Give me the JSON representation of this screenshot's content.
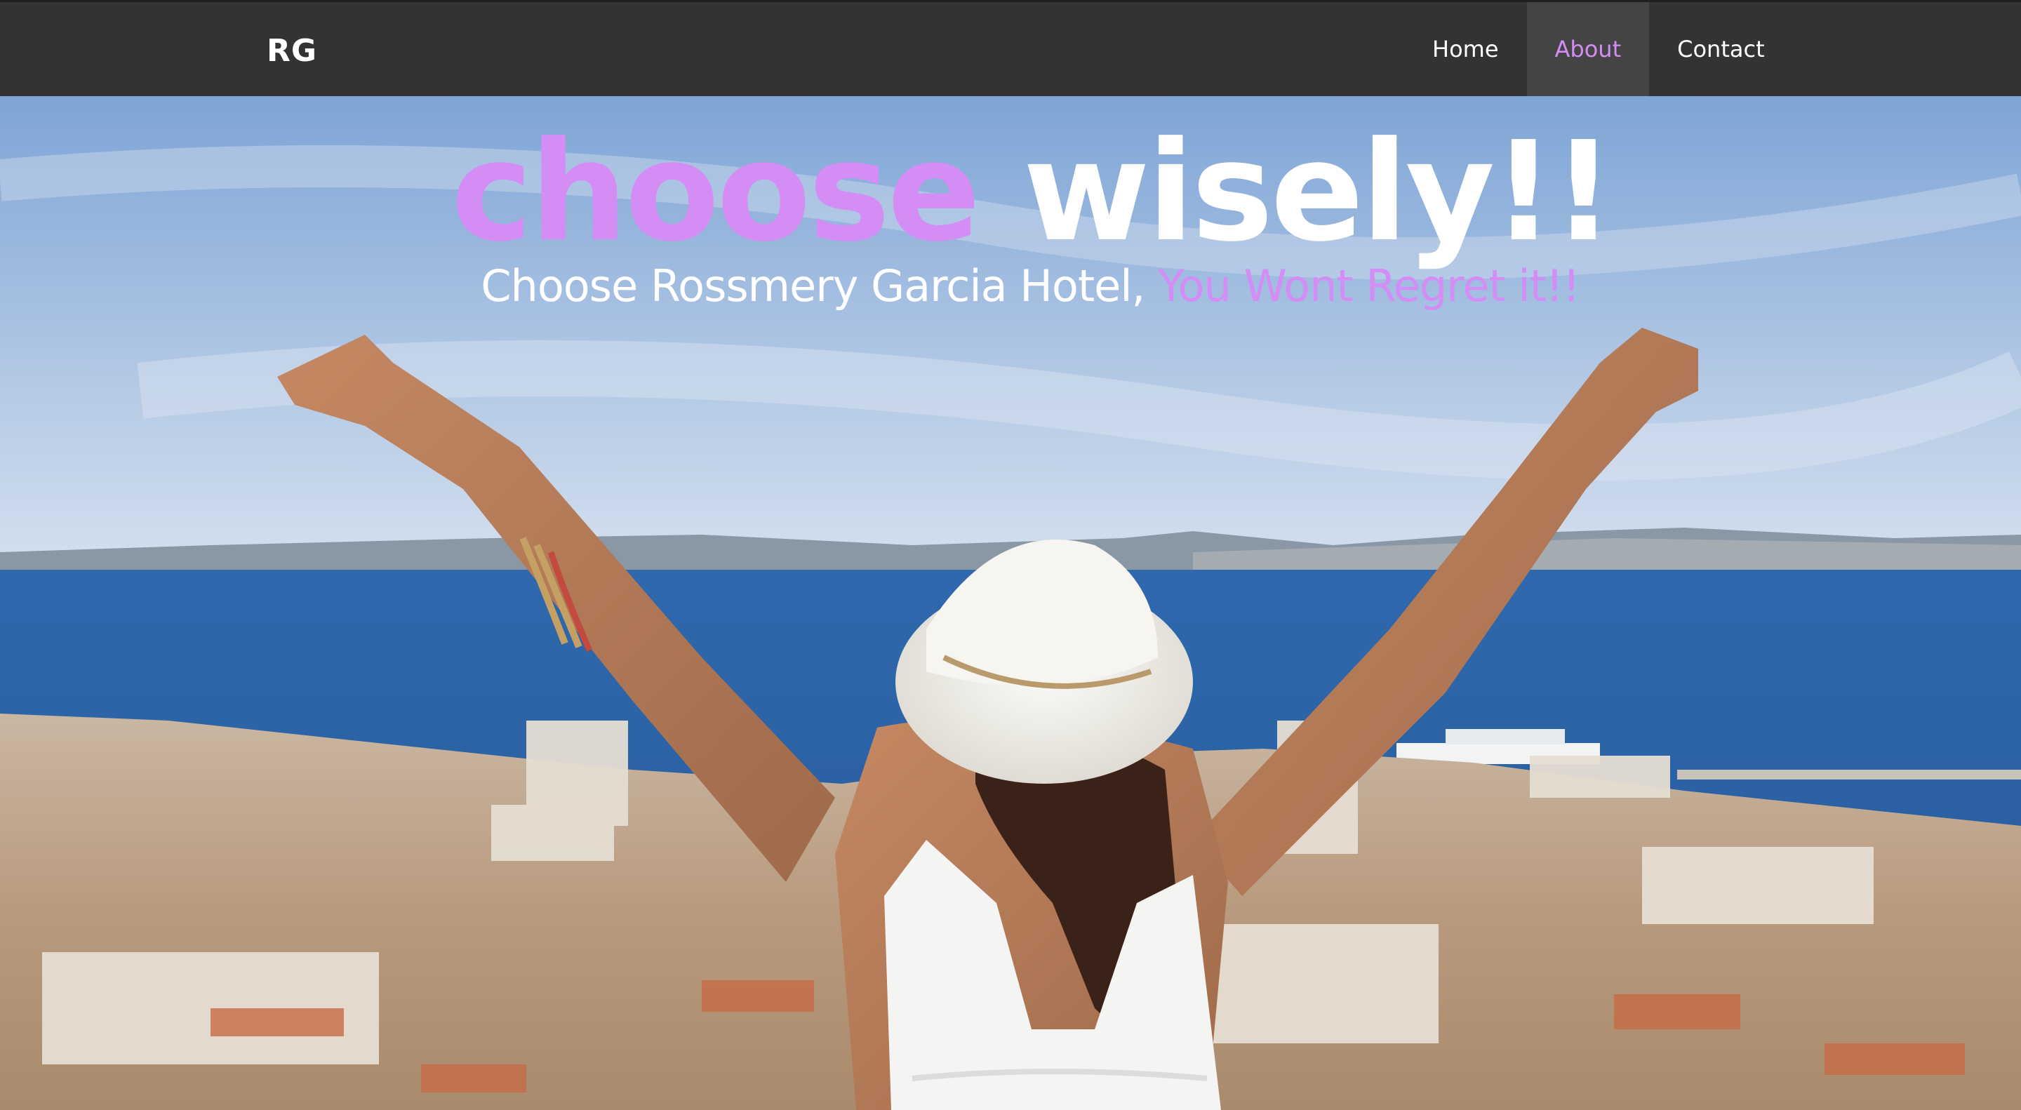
{
  "navbar": {
    "brand": "RG",
    "items": [
      {
        "label": "Home"
      },
      {
        "label": "About"
      },
      {
        "label": "Contact"
      }
    ],
    "active_item": "About"
  },
  "hero": {
    "title_part1": "choose",
    "title_part2": " wisely!!",
    "subtitle_part1": "Choose Rossmery Garcia Hotel, ",
    "subtitle_part2": "You Wont Regret it!!",
    "image_description": "woman-arms-raised-overlooking-coastal-city"
  },
  "colors": {
    "navbar_bg": "#333333",
    "accent": "#d38df5",
    "active_bg": "#444444",
    "text": "#ffffff"
  }
}
